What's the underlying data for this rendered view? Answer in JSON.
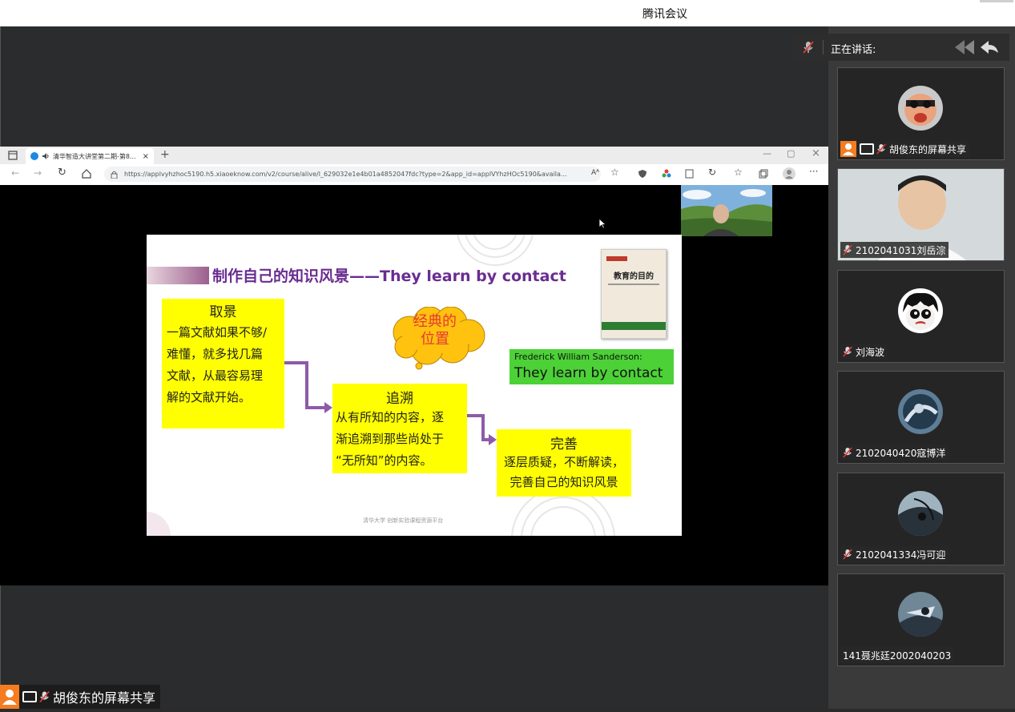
{
  "window": {
    "title": "腾讯会议"
  },
  "speaking": {
    "label": "正在讲话:"
  },
  "participants": [
    {
      "name": "胡俊东的屏幕共享",
      "sharing": true
    },
    {
      "name": "2102041031刘岳淙"
    },
    {
      "name": "刘海波"
    },
    {
      "name": "2102040420寇博洋"
    },
    {
      "name": "2102041334冯可迎"
    },
    {
      "name": "141聂兆廷2002040203"
    }
  ],
  "browser": {
    "tab_title": "清华智造大讲堂第二期-第8...",
    "url": "https://applvyhzhoc5190.h5.xiaoeknow.com/v2/course/alive/l_629032e1e4b01a4852047fdc?type=2&app_id=applVYhzHOc5190&availa...",
    "read_aloud": "Aᴬ"
  },
  "slide": {
    "title": "制作自己的知识风景——They learn by contact",
    "cloud_text_1": "经典的",
    "cloud_text_2": "位置",
    "quote_author": "Frederick William Sanderson:",
    "quote_text": "They learn by contact",
    "book_title": "教育的目的",
    "box1_title": "取景",
    "box1_l1": "一篇文献如果不够/",
    "box1_l2": "难懂，就多找几篇",
    "box1_l3": "文献，从最容易理",
    "box1_l4": "解的文献开始。",
    "box2_title": "追溯",
    "box2_l1": "从有所知的内容，逐",
    "box2_l2": "渐追溯到那些尚处于",
    "box2_l3": "“无所知”的内容。",
    "box3_title": "完善",
    "box3_l1": "逐层质疑，不断解读，",
    "box3_l2": "完善自己的知识风景",
    "footer": "清华大学 创新实验课程资源平台"
  },
  "bottom_bar": {
    "label": "胡俊东的屏幕共享"
  },
  "colors": {
    "accent_orange": "#f57c1f",
    "slide_yellow": "#ffff00",
    "slide_green": "#4cd137",
    "title_purple": "#6a2c91"
  }
}
